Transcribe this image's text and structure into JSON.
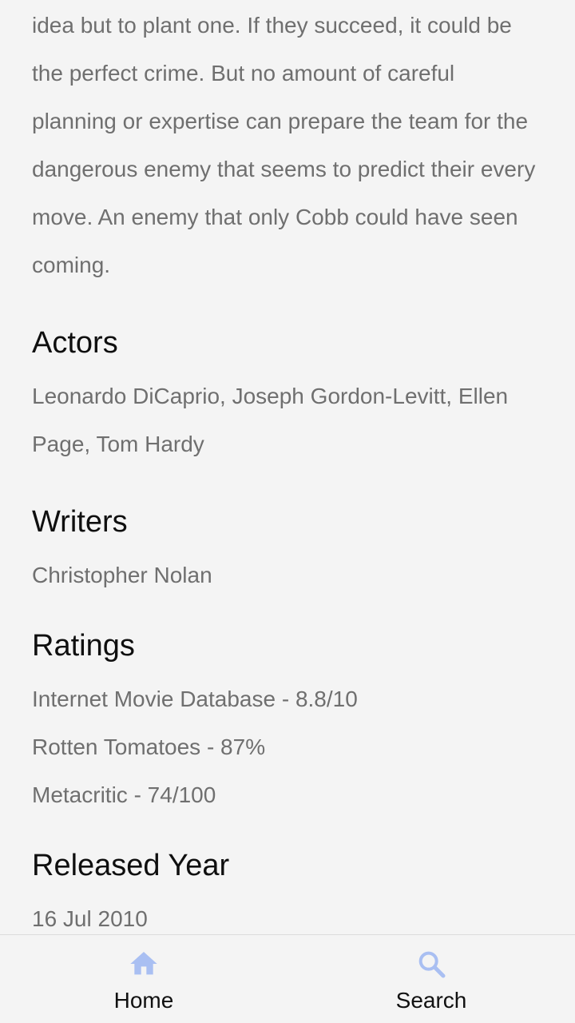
{
  "plot": {
    "text": "idea but to plant one. If they succeed, it could be the perfect crime. But no amount of careful planning or expertise can prepare the team for the dangerous enemy that seems to predict their every move. An enemy that only Cobb could have seen coming."
  },
  "actors": {
    "title": "Actors",
    "text": "Leonardo DiCaprio, Joseph Gordon-Levitt, Ellen Page, Tom Hardy"
  },
  "writers": {
    "title": "Writers",
    "text": "Christopher Nolan"
  },
  "ratings": {
    "title": "Ratings",
    "items": [
      "Internet Movie Database - 8.8/10",
      "Rotten Tomatoes - 87%",
      "Metacritic - 74/100"
    ]
  },
  "released": {
    "title": "Released Year",
    "text": "16 Jul 2010"
  },
  "bottom_nav": {
    "home_label": "Home",
    "home_icon": "home-icon",
    "search_label": "Search",
    "search_icon": "search-icon",
    "icon_color": "#a9bff2"
  }
}
